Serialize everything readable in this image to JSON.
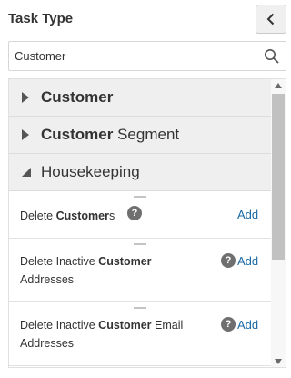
{
  "header": {
    "title": "Task Type",
    "back_icon": "chevron-left-icon"
  },
  "search": {
    "value": "Customer",
    "icon": "search-icon"
  },
  "categories": [
    {
      "bold": "Customer",
      "rest": "",
      "expanded": false
    },
    {
      "bold": "Customer",
      "rest": " Segment",
      "expanded": false
    },
    {
      "bold": "",
      "rest": "Housekeeping",
      "expanded": true
    }
  ],
  "tasks": [
    {
      "pre": "Delete ",
      "bold": "Customer",
      "post": "s",
      "line2": "",
      "action": "Add"
    },
    {
      "pre": "Delete Inactive ",
      "bold": "Customer",
      "post": "",
      "line2": "Addresses",
      "action": "Add"
    },
    {
      "pre": "Delete Inactive ",
      "bold": "Customer",
      "post": " Email",
      "line2": "Addresses",
      "action": "Add"
    }
  ],
  "help_glyph": "?",
  "colors": {
    "link": "#1b6aa5",
    "category_bg": "#efefef"
  }
}
